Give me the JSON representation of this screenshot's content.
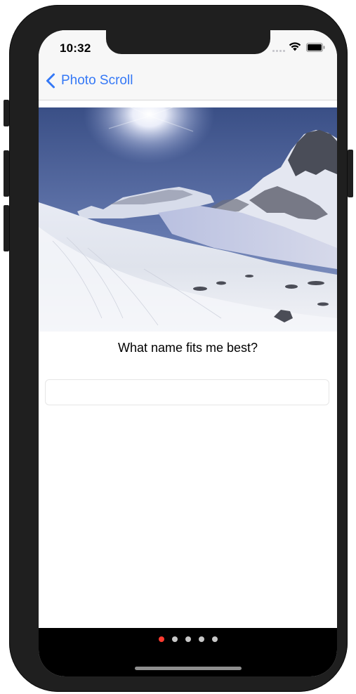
{
  "status_bar": {
    "time": "10:32",
    "icons": [
      "cellular-signal-icon",
      "wifi-icon",
      "battery-icon"
    ]
  },
  "nav": {
    "back_label": "Photo Scroll",
    "back_icon": "chevron-left-icon",
    "tint_color": "#3478f6"
  },
  "photo": {
    "subject": "snowy-mountain-landscape"
  },
  "question": {
    "text": "What name fits me best?"
  },
  "name_input": {
    "value": "",
    "placeholder": ""
  },
  "page_control": {
    "count": 5,
    "current_index": 0,
    "active_color": "#ff3b30",
    "inactive_color": "#c7c7c7"
  }
}
